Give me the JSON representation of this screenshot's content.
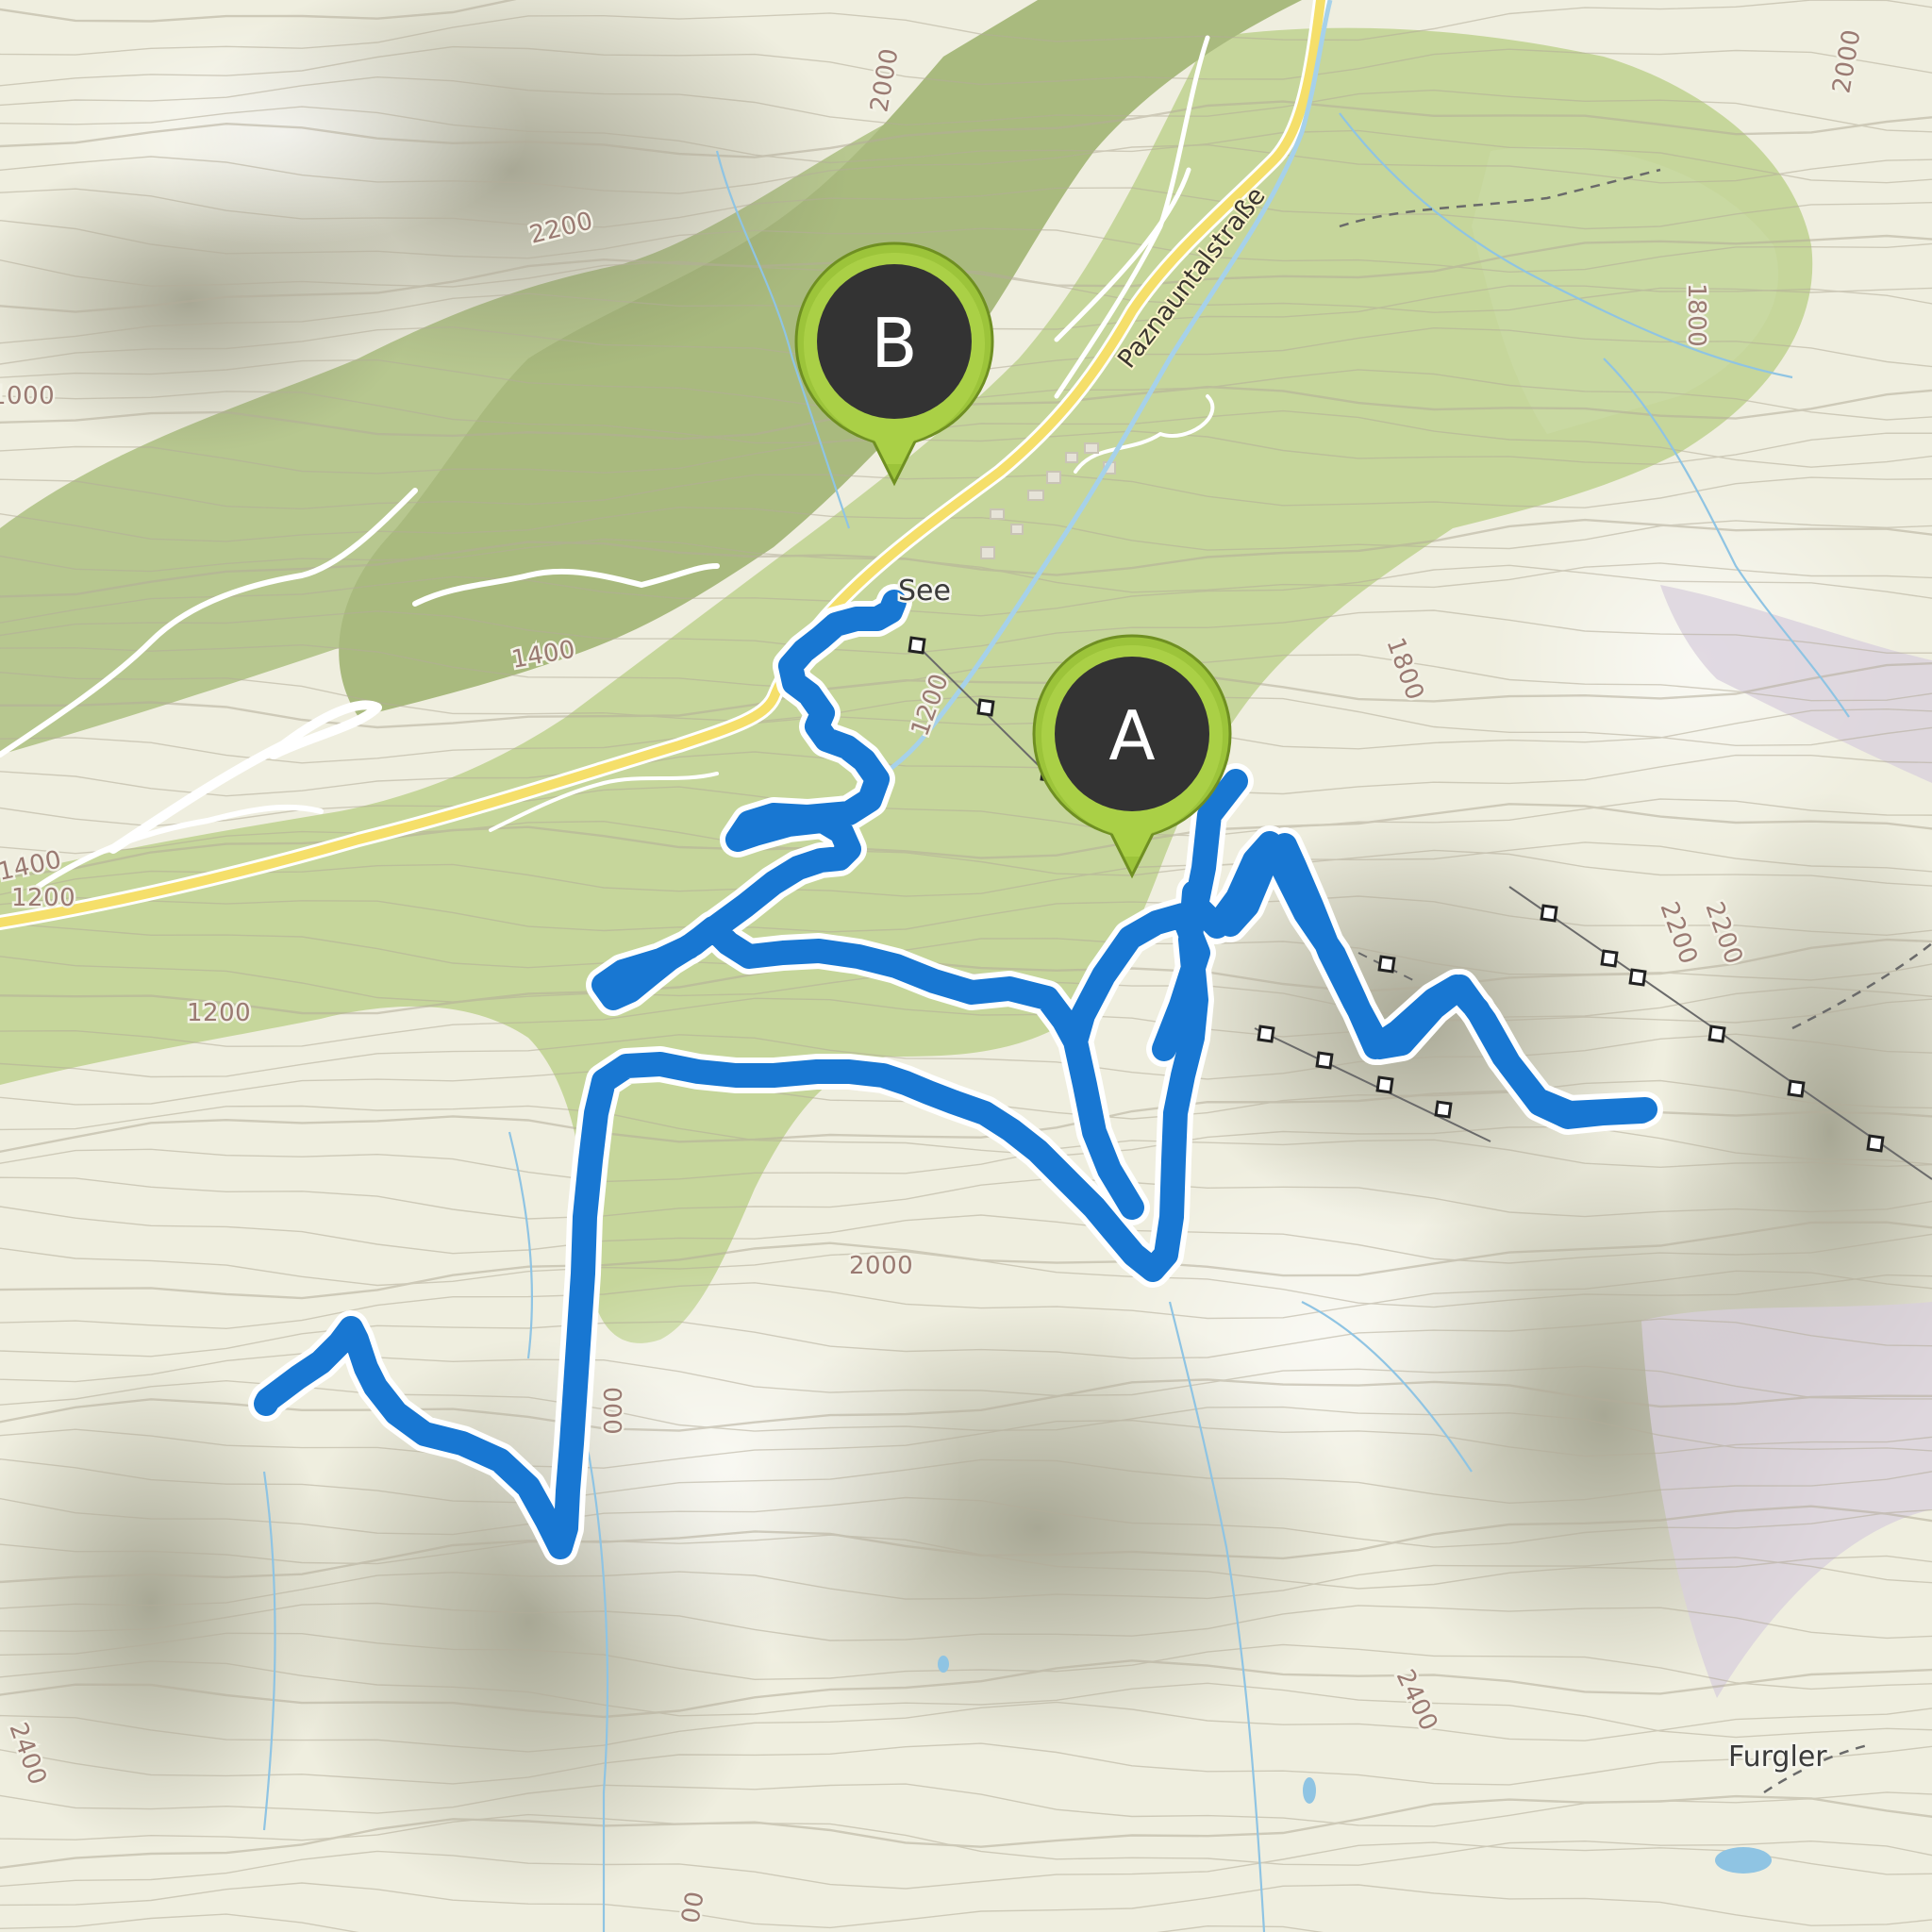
{
  "map": {
    "colors": {
      "background": "#efeedf",
      "forest": "#c9d9a2",
      "forest_dark": "#aebf85",
      "route": "#1877d2",
      "road": "#f7e47a",
      "water": "#8fc4e3",
      "marker": "#9cc43a",
      "marker_inner": "#333333"
    },
    "places": [
      {
        "id": "see",
        "label": "See"
      },
      {
        "id": "furgler",
        "label": "Furgler"
      }
    ],
    "roads": [
      {
        "id": "paznauntalstrasse",
        "label": "Paznauntalstraße"
      }
    ],
    "elevation_labels": [
      "2200",
      "2000",
      "1800",
      "1800",
      "2000",
      "1400",
      "1200",
      "1200",
      "1400",
      "2000",
      "2200",
      "2400",
      "2400",
      "1000",
      "1200",
      "2200",
      "000",
      "00"
    ],
    "markers": [
      {
        "id": "start",
        "letter": "A",
        "icon": "map-pin-icon"
      },
      {
        "id": "end",
        "letter": "B",
        "icon": "map-pin-icon"
      }
    ]
  }
}
